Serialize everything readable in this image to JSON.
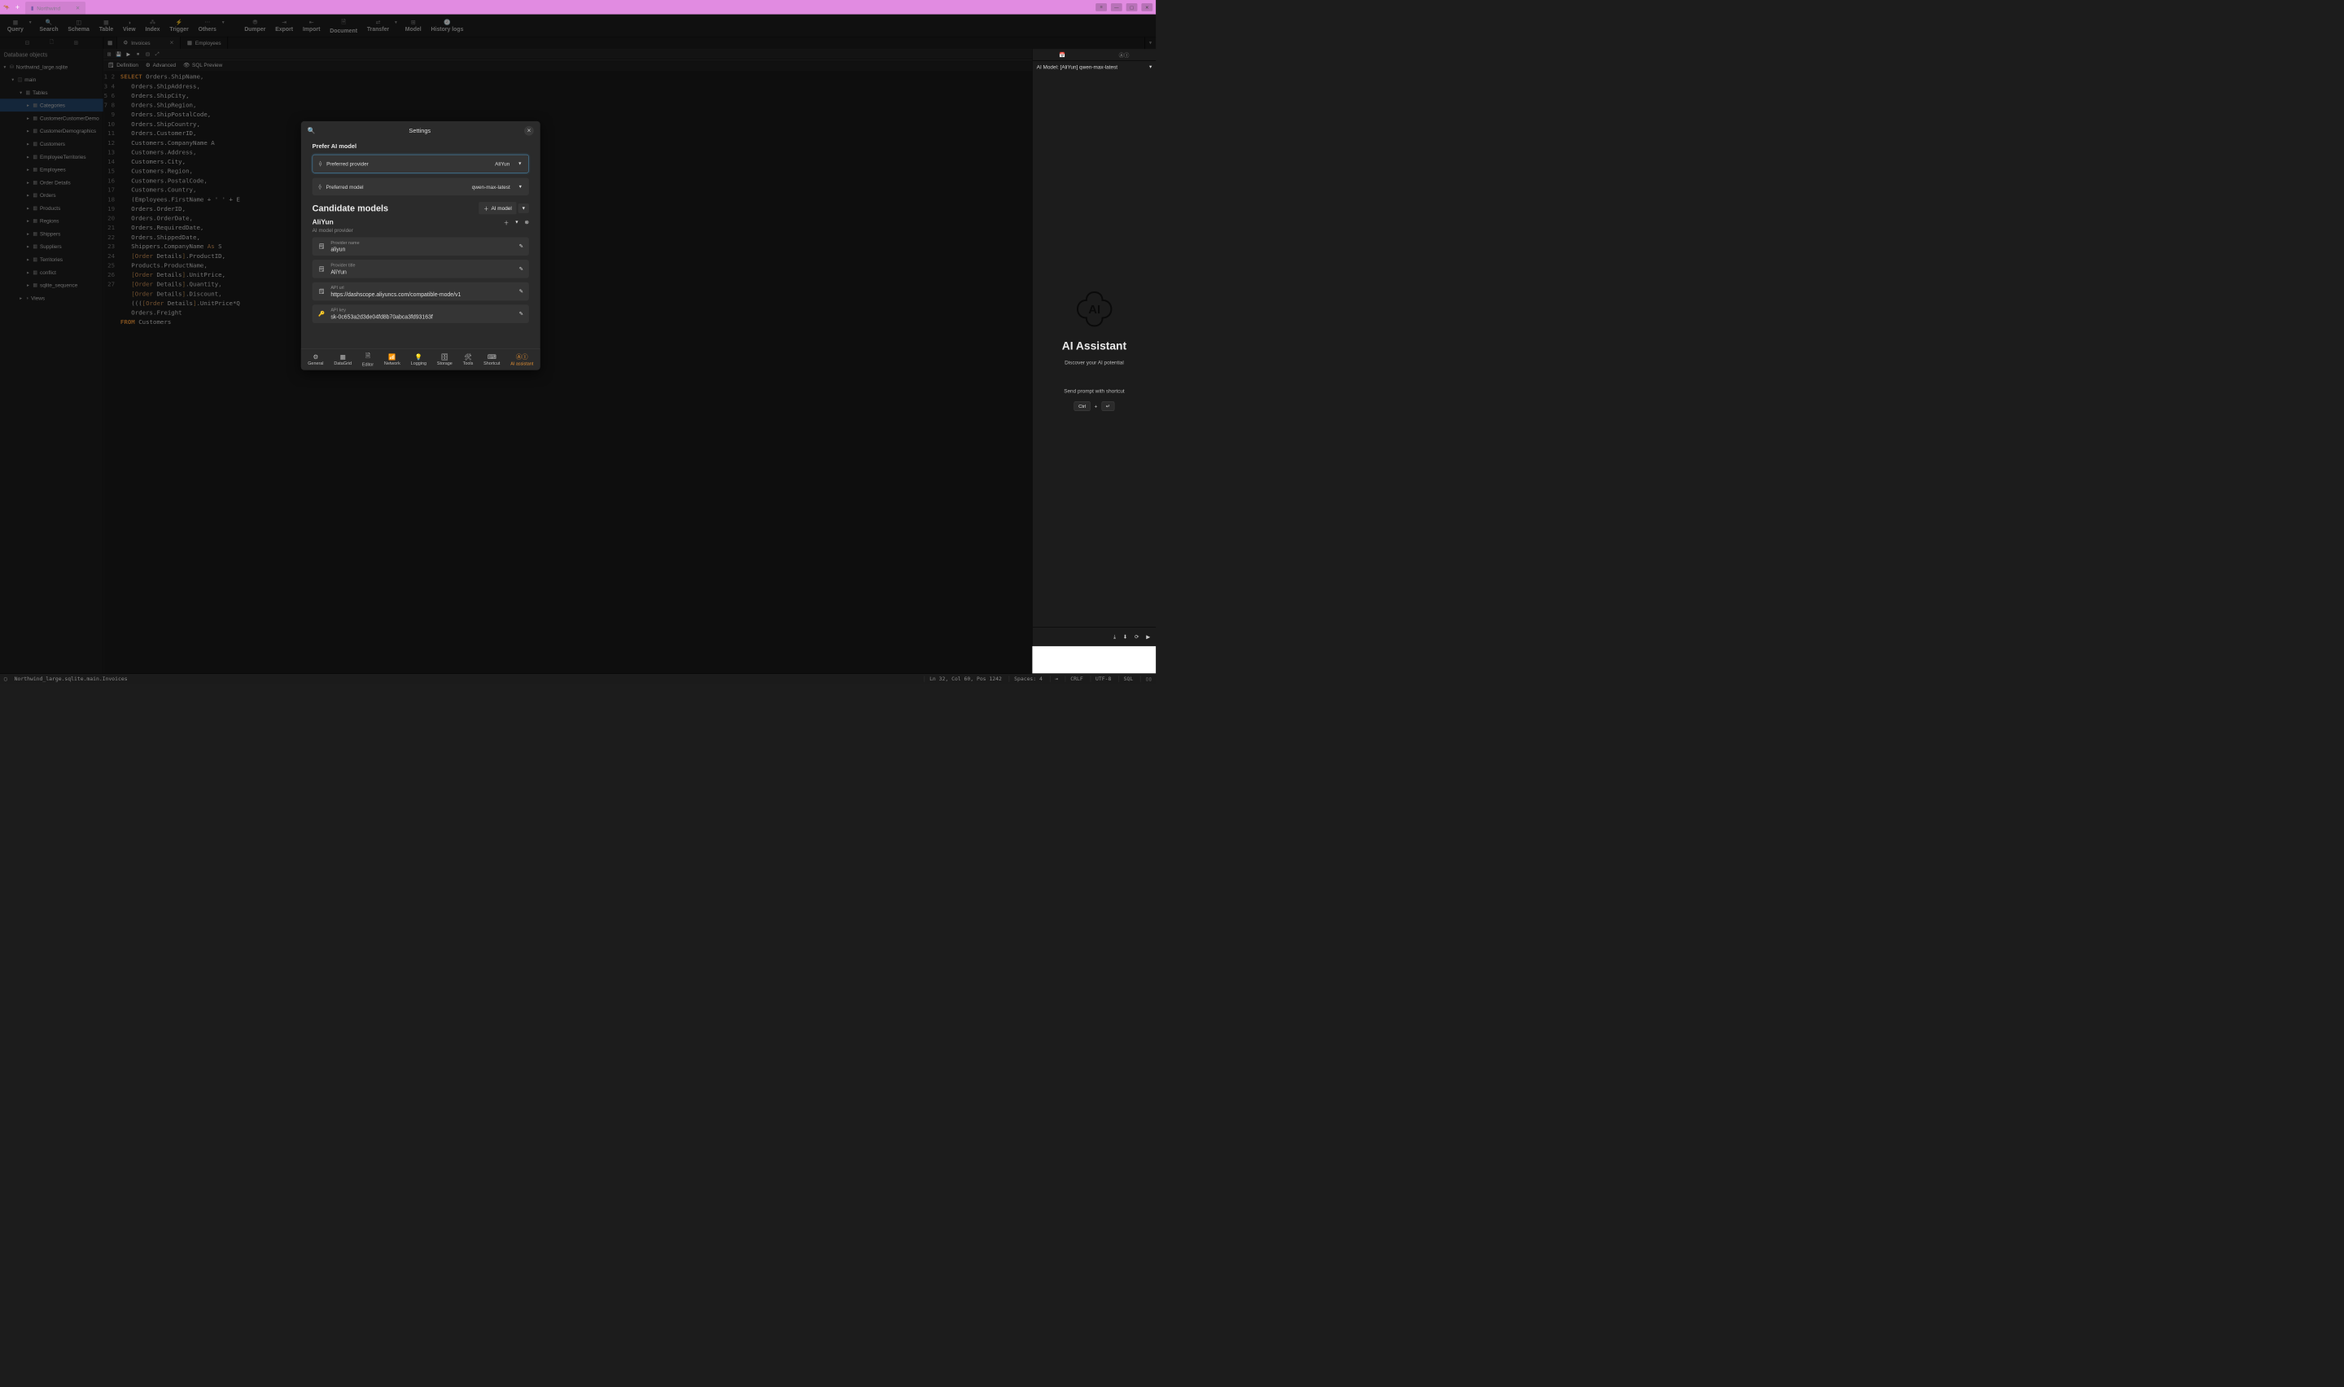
{
  "titlebar": {
    "tab_label": "Northwind"
  },
  "toolbar": {
    "items": [
      "Query",
      "Search",
      "Schema",
      "Table",
      "View",
      "Index",
      "Trigger",
      "Others",
      "Dumper",
      "Export",
      "Import",
      "Document",
      "Transfer",
      "Model",
      "History logs"
    ]
  },
  "content_tabs": {
    "invoices": "Invoices",
    "employees": "Employees"
  },
  "sidebar": {
    "header": "Database objects",
    "db": "Northwind_large.sqlite",
    "schema": "main",
    "tables_label": "Tables",
    "views_label": "Views",
    "tables": [
      "Categories",
      "CustomerCustomerDemo",
      "CustomerDemographics",
      "Customers",
      "EmployeeTerritories",
      "Employees",
      "Order Details",
      "Orders",
      "Products",
      "Regions",
      "Shippers",
      "Suppliers",
      "Territories",
      "conflict",
      "sqlite_sequence"
    ]
  },
  "subtoolbar": {
    "definition": "Definition",
    "advanced": "Advanced",
    "preview": "SQL Preview"
  },
  "code": {
    "lines": [
      "SELECT Orders.ShipName,",
      "   Orders.ShipAddress,",
      "   Orders.ShipCity,",
      "   Orders.ShipRegion,",
      "   Orders.ShipPostalCode,",
      "   Orders.ShipCountry,",
      "   Orders.CustomerID,",
      "   Customers.CompanyName A",
      "   Customers.Address,",
      "   Customers.City,",
      "   Customers.Region,",
      "   Customers.PostalCode,",
      "   Customers.Country,",
      "   (Employees.FirstName + ' ' + E",
      "   Orders.OrderID,",
      "   Orders.OrderDate,",
      "   Orders.RequiredDate,",
      "   Orders.ShippedDate,",
      "   Shippers.CompanyName As S",
      "   [Order Details].ProductID,",
      "   Products.ProductName,",
      "   [Order Details].UnitPrice,",
      "   [Order Details].Quantity,",
      "   [Order Details].Discount,",
      "   ((([Order Details].UnitPrice*Q",
      "   Orders.Freight",
      "FROM Customers"
    ]
  },
  "right_panel": {
    "model_row": "AI Model: [AliYun] qwen-max-latest",
    "title": "AI Assistant",
    "subtitle": "Discover your AI potential",
    "prompt_hint": "Send prompt with shortcut",
    "kbd_ctrl": "Ctrl",
    "kbd_enter": "↵"
  },
  "modal": {
    "title": "Settings",
    "section1": "Prefer AI model",
    "pref_provider_label": "Preferred provider",
    "pref_provider_value": "AliYun",
    "pref_model_label": "Preferred model",
    "pref_model_value": "qwen-max-latest",
    "section2": "Candidate models",
    "add_btn": "AI model",
    "provider_name": "AliYun",
    "provider_sub": "AI model provider",
    "fields": {
      "name_label": "Provider name",
      "name_value": "aliyun",
      "title_label": "Provider title",
      "title_value": "AliYun",
      "url_label": "API url",
      "url_value": "https://dashscope.aliyuncs.com/compatible-mode/v1",
      "key_label": "API key",
      "key_value": "sk-0c653a2d3de04fd8b70abca3fd93163f"
    },
    "footer": [
      "General",
      "DataGrid",
      "Editor",
      "Network",
      "Logging",
      "Storage",
      "Tools",
      "Shortcut",
      "AI assistant"
    ]
  },
  "statusbar": {
    "path": "Northwind_large.sqlite.main.Invoices",
    "pos": "Ln 32, Col 60, Pos 1242",
    "spaces": "Spaces: 4",
    "eol": "CRLF",
    "enc": "UTF-8",
    "lang": "SQL"
  }
}
